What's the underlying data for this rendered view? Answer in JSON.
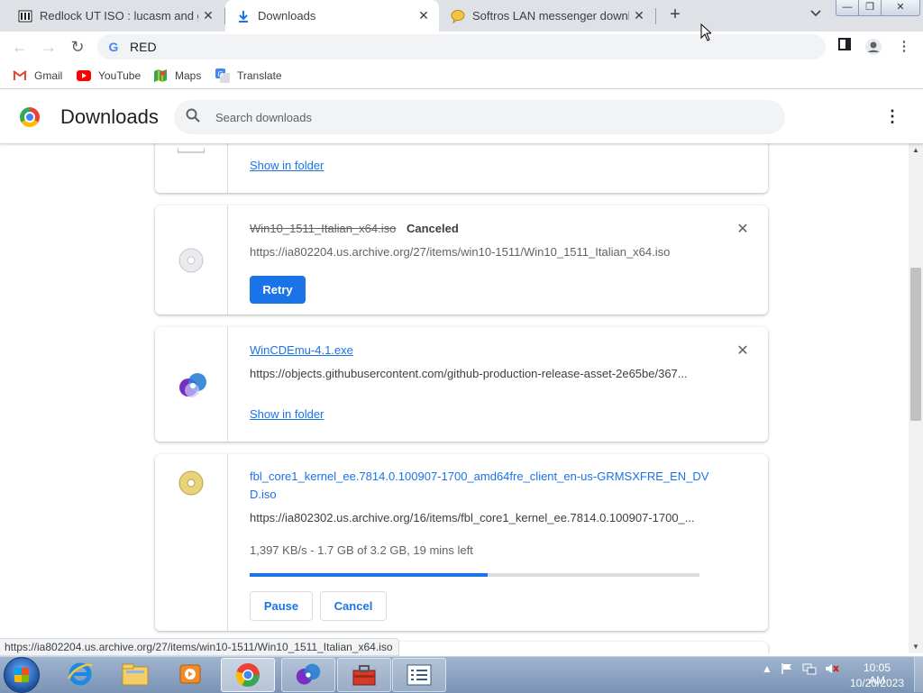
{
  "tabs": [
    {
      "title": "Redlock UT ISO : lucasm and gus",
      "icon": "archive-icon"
    },
    {
      "title": "Downloads",
      "icon": "download-icon"
    },
    {
      "title": "Softros LAN messenger downloa",
      "icon": "chat-bubble-icon"
    }
  ],
  "window_controls": {
    "minimize": "—",
    "restore": "❐",
    "close": "✕"
  },
  "toolbar": {
    "address": "RED"
  },
  "bookmarks": [
    "Gmail",
    "YouTube",
    "Maps",
    "Translate"
  ],
  "header": {
    "title": "Downloads",
    "search_placeholder": "Search downloads"
  },
  "downloads": [
    {
      "action": "Show in folder"
    },
    {
      "name": "Win10_1511_Italian_x64.iso",
      "status": "Canceled",
      "url": "https://ia802204.us.archive.org/27/items/win10-1511/Win10_1511_Italian_x64.iso",
      "action": "Retry"
    },
    {
      "name": "WinCDEmu-4.1.exe",
      "url": "https://objects.githubusercontent.com/github-production-release-asset-2e65be/367...",
      "action": "Show in folder"
    },
    {
      "name_line1": "fbl_core1_kernel_ee.7814.0.100907-1700_amd64fre_client_en-us-GRMSXFRE_EN_DV",
      "name_line2": "D.iso",
      "url": "https://ia802302.us.archive.org/16/items/fbl_core1_kernel_ee.7814.0.100907-1700_...",
      "progress_text": "1,397 KB/s - 1.7 GB of 3.2 GB, 19 mins left",
      "progress": 0.53,
      "pause": "Pause",
      "cancel": "Cancel"
    }
  ],
  "status_url": "https://ia802204.us.archive.org/27/items/win10-1511/Win10_1511_Italian_x64.iso",
  "clock": {
    "time": "10:05 AM",
    "date": "10/20/2023"
  },
  "colors": {
    "accent": "#1a73e8",
    "tabstrip": "#dee1e6",
    "taskbar": "#7a93b5"
  }
}
